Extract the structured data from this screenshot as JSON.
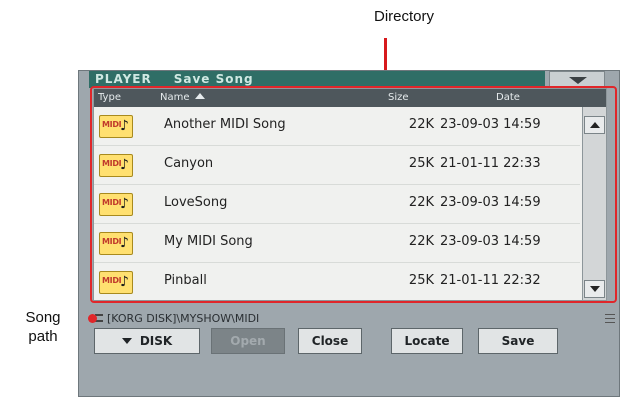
{
  "annotations": {
    "directory_label": "Directory",
    "song_path_line1": "Song",
    "song_path_line2": "path",
    "accent_color": "#e0262a"
  },
  "window": {
    "title_mode": "PLAYER",
    "title_page": "Save Song",
    "menu_icon": "chevron-down-icon"
  },
  "table": {
    "columns": {
      "type": "Type",
      "name": "Name",
      "size": "Size",
      "date": "Date"
    },
    "sort_column": "Name",
    "rows": [
      {
        "type_icon": "MIDI",
        "name": "Another MIDI Song",
        "size": "22K",
        "date": "23-09-03 14:59"
      },
      {
        "type_icon": "MIDI",
        "name": "Canyon",
        "size": "25K",
        "date": "21-01-11 22:33"
      },
      {
        "type_icon": "MIDI",
        "name": "LoveSong",
        "size": "22K",
        "date": "23-09-03 14:59"
      },
      {
        "type_icon": "MIDI",
        "name": "My MIDI Song",
        "size": "22K",
        "date": "23-09-03 14:59"
      },
      {
        "type_icon": "MIDI",
        "name": "Pinball",
        "size": "25K",
        "date": "21-01-11 22:32"
      }
    ]
  },
  "path": {
    "value": "[KORG DISK]\\MYSHOW\\MIDI"
  },
  "buttons": {
    "disk": "DISK",
    "open": "Open",
    "close": "Close",
    "locate": "Locate",
    "save": "Save"
  }
}
